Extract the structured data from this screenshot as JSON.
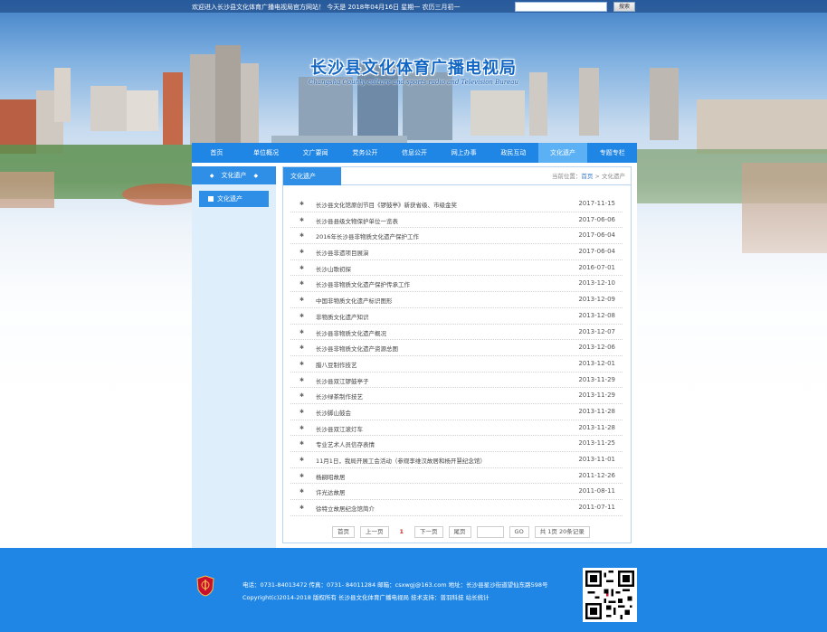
{
  "topbar": {
    "welcome": "欢迎进入长沙县文化体育广播电视局官方网站！   今天是 2018年04月16日 星期一 农历三月初一",
    "search_button": "搜索"
  },
  "header": {
    "title": "长沙县文化体育广播电视局",
    "subtitle": "Changsha County culture and sports radio and Television Bureau"
  },
  "nav": {
    "items": [
      {
        "label": "首页"
      },
      {
        "label": "单位概况"
      },
      {
        "label": "文广要闻"
      },
      {
        "label": "党务公开"
      },
      {
        "label": "信息公开"
      },
      {
        "label": "网上办事"
      },
      {
        "label": "政民互动"
      },
      {
        "label": "文化遗产"
      },
      {
        "label": "专题专栏"
      }
    ],
    "active_index": 7
  },
  "sidebar": {
    "heading": "文化遗产",
    "items": [
      {
        "label": "文化遗产"
      }
    ]
  },
  "content": {
    "tab": "文化遗产",
    "breadcrumb_prefix": "当前位置：",
    "breadcrumb_home": "首页",
    "breadcrumb_sep": " > ",
    "breadcrumb_current": "文化遗产",
    "news": [
      {
        "title": "长沙县文化馆原创节目《锣鼓亭》新获省级、市级金奖",
        "date": "2017-11-15"
      },
      {
        "title": "长沙县县级文物保护单位一览表",
        "date": "2017-06-06"
      },
      {
        "title": "2016年长沙县非物质文化遗产保护工作",
        "date": "2017-06-04"
      },
      {
        "title": "长沙县非遗项目展演",
        "date": "2017-06-04"
      },
      {
        "title": "长沙山歌初探",
        "date": "2016-07-01"
      },
      {
        "title": "长沙县非物质文化遗产保护传承工作",
        "date": "2013-12-10"
      },
      {
        "title": "中国非物质文化遗产标识图形",
        "date": "2013-12-09"
      },
      {
        "title": "非物质文化遗产知识",
        "date": "2013-12-08"
      },
      {
        "title": "长沙县非物质文化遗产概况",
        "date": "2013-12-07"
      },
      {
        "title": "长沙县非物质文化遗产资源总图",
        "date": "2013-12-06"
      },
      {
        "title": "腊八豆制作技艺",
        "date": "2013-12-01"
      },
      {
        "title": "长沙县双江锣鼓亭子",
        "date": "2013-11-29"
      },
      {
        "title": "长沙绿茶制作技艺",
        "date": "2013-11-29"
      },
      {
        "title": "长沙脚山鼓会",
        "date": "2013-11-28"
      },
      {
        "title": "长沙县双江滚灯车",
        "date": "2013-11-28"
      },
      {
        "title": "专业艺术人员信存表情",
        "date": "2013-11-25"
      },
      {
        "title": "11月1日，我局开展工会活动（参观李维汉故居和杨开慧纪念馆）",
        "date": "2013-11-01"
      },
      {
        "title": "杨嗣昭故居",
        "date": "2011-12-26"
      },
      {
        "title": "许光达故居",
        "date": "2011-08-11"
      },
      {
        "title": "徐特立故居纪念馆简介",
        "date": "2011-07-11"
      }
    ]
  },
  "pager": {
    "first": "首页",
    "prev": "上一页",
    "current": "1",
    "next": "下一页",
    "last": "尾页",
    "go": "GO",
    "summary": "共 1页 20条记录"
  },
  "footer": {
    "line1": "电话：0731-84013472  传真：0731- 84011284  邮箱：csxwgj@163.com  地址：长沙县星沙街道望仙东路598号",
    "line2": "Copyright(c)2014-2018 版权所有 长沙县文化体育广播电视局   技术支持：普羽科技   站长统计"
  },
  "colors": {
    "primary": "#1f86e6",
    "nav_active": "#5cb1f4",
    "title": "#1266c4"
  }
}
